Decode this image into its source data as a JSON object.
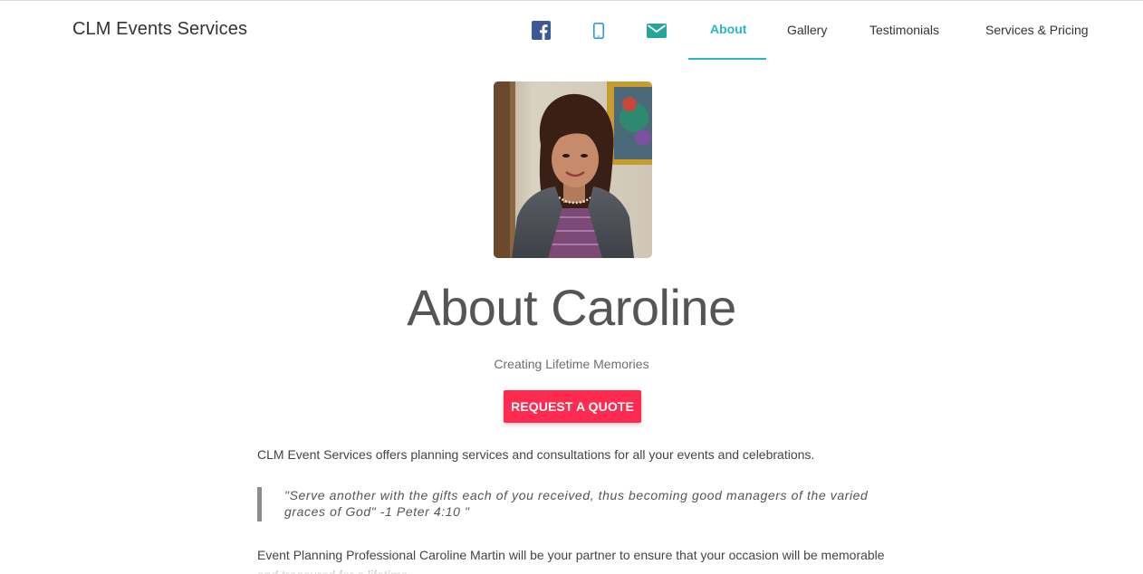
{
  "navbar": {
    "brand": "CLM Events Services",
    "icons": [
      {
        "name": "facebook-icon",
        "color": "#3b5998"
      },
      {
        "name": "mobile-phone-icon",
        "color": "#2a9fd6"
      },
      {
        "name": "envelope-icon",
        "color": "#26a69a"
      }
    ],
    "links": [
      {
        "label": "About",
        "active": true
      },
      {
        "label": "Gallery",
        "active": false
      },
      {
        "label": "Testimonials",
        "active": false
      },
      {
        "label": "Services & Pricing",
        "active": false
      }
    ],
    "active_color": "#26b6c9"
  },
  "hero": {
    "title": "About Caroline",
    "subtitle": "Creating Lifetime Memories",
    "cta_label": "REQUEST A QUOTE",
    "cta_color": "#ff2a4f"
  },
  "content": {
    "intro": "CLM Event Services offers planning services and consultations for all your events and celebrations.",
    "scripture": "\"Serve another with the gifts each of you received, thus becoming good managers of the varied graces of God\" -1 Peter 4:10 \"",
    "partner": "Event Planning Professional Caroline Martin will be your partner to ensure that your occasion will be memorable and treasured for a lifetime."
  }
}
